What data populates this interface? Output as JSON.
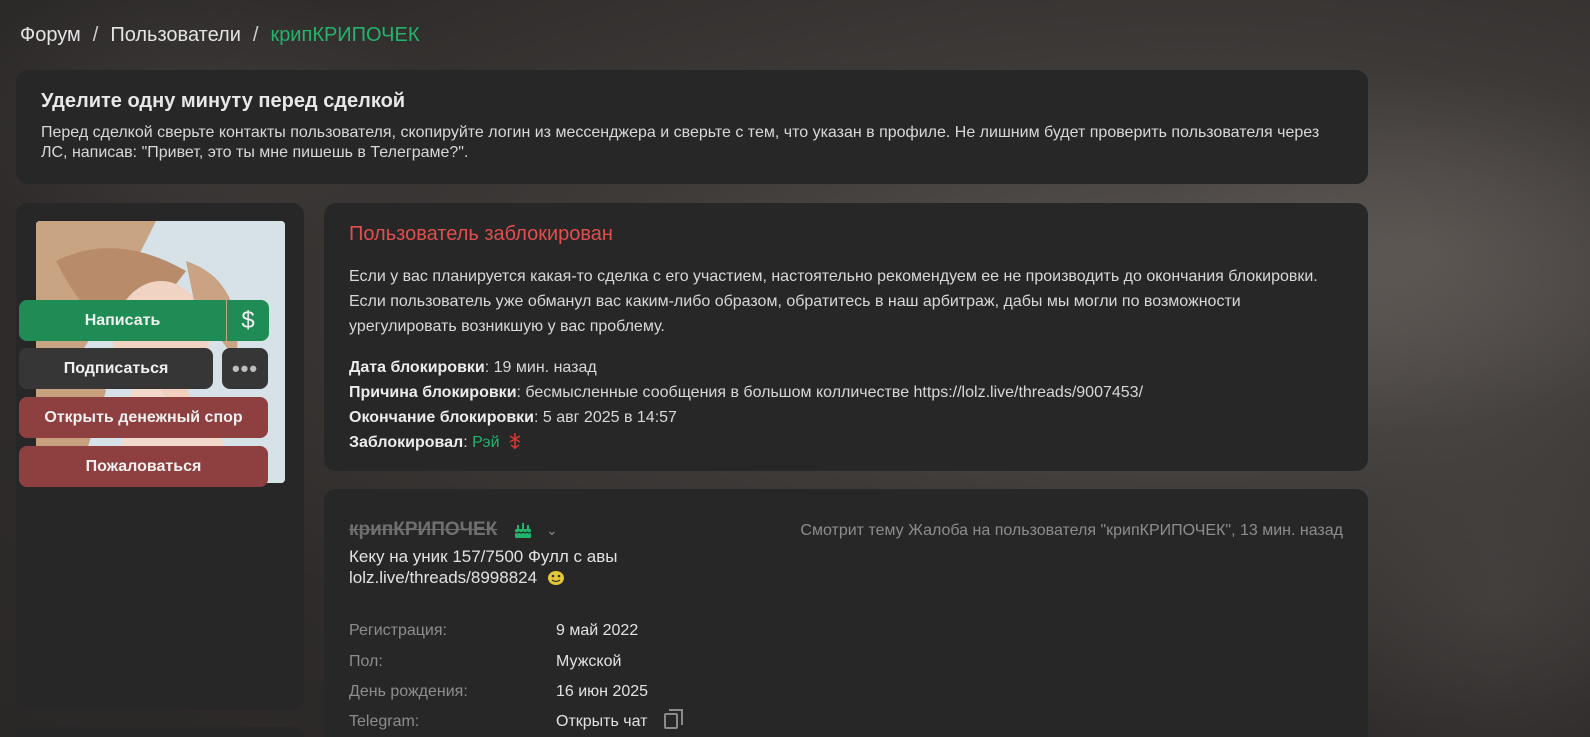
{
  "breadcrumb": {
    "items": [
      "Форум",
      "Пользователи"
    ],
    "separator": "/",
    "current": "крипКРИПОЧЕК"
  },
  "notice": {
    "title": "Уделите одну минуту перед сделкой",
    "text": "Перед сделкой сверьте контакты пользователя, скопируйте логин из мессенджера и сверьте с тем, что указан в профиле. Не лишним будет проверить пользователя через ЛС, написав: \"Привет, это ты мне пишешь в Телеграме?\"."
  },
  "sidebar": {
    "buttons": {
      "write": "Написать",
      "money_icon": "$",
      "subscribe": "Подписаться",
      "more_icon": "•••",
      "dispute": "Открыть денежный спор",
      "report": "Пожаловаться"
    }
  },
  "ban": {
    "title": "Пользователь заблокирован",
    "description": "Если у вас планируется какая-то сделка с его участием, настоятельно рекомендуем ее не производить до окончания блокировки. Если пользователь уже обманул вас каким-либо образом, обратитесь в наш арбитраж, дабы мы могли по возможности урегулировать возникшую у вас проблему.",
    "date_label": "Дата блокировки",
    "date_value": "19 мин. назад",
    "reason_label": "Причина блокировки",
    "reason_value": "бесмысленные сообщения в большом колличестве https://lolz.live/threads/9007453/",
    "end_label": "Окончание блокировки",
    "end_value": "5 авг 2025 в 14:57",
    "by_label": "Заблокировал",
    "by_value": "Рэй"
  },
  "profile": {
    "username": "крипКРИПОЧЕК",
    "status_line1": "Кеку на уник 157/7500 Фулл с авы",
    "status_line2": "lolz.live/threads/8998824",
    "viewing": "Смотрит тему Жалоба на пользователя \"крипКРИПОЧЕК\", 13 мин. назад",
    "info": [
      {
        "label": "Регистрация:",
        "value": "9 май 2022"
      },
      {
        "label": "Пол:",
        "value": "Мужской"
      },
      {
        "label": "День рождения:",
        "value": "16 июн 2025"
      },
      {
        "label": "Telegram:",
        "value": "Открыть чат"
      }
    ]
  },
  "colors": {
    "accent_green": "#22b46c",
    "danger_red": "#e04e4e",
    "button_green": "#1f8c55",
    "button_red": "#8e3f40",
    "panel": "#272727"
  }
}
